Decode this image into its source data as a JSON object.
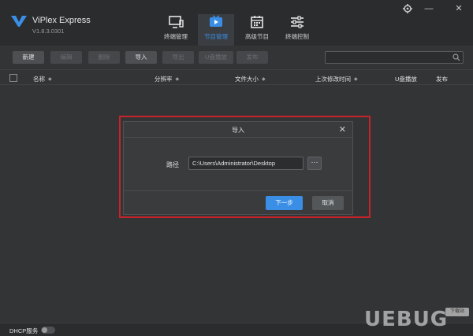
{
  "app": {
    "name": "ViPlex Express",
    "version": "V1.8.3.0301"
  },
  "nav": [
    {
      "label": "终端管理",
      "icon": "monitor-icon"
    },
    {
      "label": "节目管理",
      "icon": "play-icon",
      "active": true
    },
    {
      "label": "高级节目",
      "icon": "calendar-icon"
    },
    {
      "label": "终端控制",
      "icon": "sliders-icon"
    }
  ],
  "window": {
    "settings_icon": "gear-icon",
    "min_label": "—",
    "close_label": "✕"
  },
  "toolbar": {
    "new_label": "新建",
    "edit_label": "编辑",
    "delete_label": "删除",
    "import_label": "导入",
    "export_label": "导出",
    "usb_play_label": "U盘播放",
    "publish_label": "发布",
    "search_placeholder": ""
  },
  "table": {
    "columns": [
      "名称",
      "分辨率",
      "文件大小",
      "上次修改时间",
      "U盘播放",
      "发布"
    ],
    "sort_glyph": "◆"
  },
  "dialog": {
    "title": "导入",
    "close_label": "✕",
    "path_label": "路径",
    "path_value": "C:\\Users\\Administrator\\Desktop",
    "browse_label": "···",
    "next_label": "下一步",
    "cancel_label": "取消"
  },
  "footer": {
    "dhcp_label": "DHCP服务",
    "dhcp_enabled": false
  },
  "watermark": {
    "text": "UEBUG",
    "badge": "下载站"
  },
  "colors": {
    "accent": "#3a8ee6",
    "highlight": "#c7232a",
    "background": "#333436"
  }
}
